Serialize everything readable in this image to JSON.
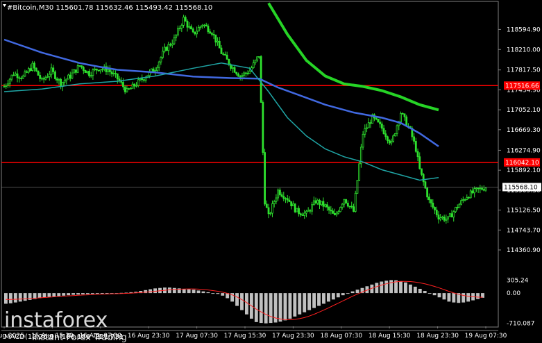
{
  "chart_data": [
    {
      "type": "candlestick",
      "title": "#Bitcoin,M30  115601.78 115632.46 115493.42 115568.10",
      "symbol": "#Bitcoin",
      "timeframe": "M30",
      "ohlc_header": {
        "open": 115601.78,
        "high": 115632.46,
        "low": 115493.42,
        "close": 115568.1
      },
      "ylim": [
        114360.9,
        119000
      ],
      "y_ticks": [
        "118594.90",
        "118210.00",
        "117817.50",
        "117434.90",
        "117052.10",
        "116669.30",
        "116274.90",
        "115892.10",
        "115509.30",
        "115126.50",
        "114743.70",
        "114360.90"
      ],
      "x_ticks": [
        "15 Aug 2025",
        "15 Aug 15:30",
        "16 Aug 07:30",
        "16 Aug 23:30",
        "17 Aug 07:30",
        "17 Aug 15:30",
        "17 Aug 23:30",
        "18 Aug 07:30",
        "18 Aug 15:30",
        "18 Aug 23:30",
        "19 Aug 07:30"
      ],
      "close_path": [
        [
          0,
          117500
        ],
        [
          5,
          117750
        ],
        [
          10,
          117680
        ],
        [
          15,
          117900
        ],
        [
          20,
          117600
        ],
        [
          25,
          117800
        ],
        [
          30,
          117560
        ],
        [
          35,
          117700
        ],
        [
          40,
          117900
        ],
        [
          45,
          117750
        ],
        [
          50,
          117850
        ],
        [
          55,
          117820
        ],
        [
          60,
          117650
        ],
        [
          65,
          117400
        ],
        [
          70,
          117550
        ],
        [
          75,
          117700
        ],
        [
          80,
          117850
        ],
        [
          85,
          118200
        ],
        [
          90,
          118400
        ],
        [
          95,
          118800
        ],
        [
          100,
          118500
        ],
        [
          105,
          118700
        ],
        [
          110,
          118550
        ],
        [
          115,
          118150
        ],
        [
          120,
          117900
        ],
        [
          125,
          117700
        ],
        [
          130,
          117800
        ],
        [
          135,
          118100
        ],
        [
          138,
          115300
        ],
        [
          140,
          115000
        ],
        [
          145,
          115500
        ],
        [
          150,
          115350
        ],
        [
          155,
          115100
        ],
        [
          160,
          115050
        ],
        [
          165,
          115300
        ],
        [
          170,
          115200
        ],
        [
          175,
          115000
        ],
        [
          180,
          115350
        ],
        [
          185,
          115100
        ],
        [
          190,
          116600
        ],
        [
          195,
          116900
        ],
        [
          200,
          116700
        ],
        [
          205,
          116400
        ],
        [
          210,
          117000
        ],
        [
          215,
          116650
        ],
        [
          218,
          116300
        ],
        [
          220,
          115900
        ],
        [
          225,
          115300
        ],
        [
          230,
          115000
        ],
        [
          235,
          114950
        ],
        [
          240,
          115200
        ],
        [
          245,
          115400
        ],
        [
          250,
          115500
        ],
        [
          255,
          115568
        ]
      ],
      "support_lines": [
        {
          "label": "117516.66",
          "value": 117516.66,
          "color": "#ff0000"
        },
        {
          "label": "116042.10",
          "value": 116042.1,
          "color": "#ff0000"
        }
      ],
      "current_price_label": "115568.10",
      "series": [
        {
          "color": "#26d426",
          "values": [
            [
              140,
              119100
            ],
            [
              150,
              118500
            ],
            [
              160,
              118000
            ],
            [
              170,
              117700
            ],
            [
              180,
              117550
            ],
            [
              190,
              117500
            ],
            [
              200,
              117420
            ],
            [
              210,
              117300
            ],
            [
              220,
              117150
            ],
            [
              230,
              117050
            ]
          ]
        },
        {
          "color": "#4169e1",
          "values": [
            [
              0,
              118400
            ],
            [
              20,
              118150
            ],
            [
              40,
              117950
            ],
            [
              50,
              117880
            ],
            [
              60,
              117820
            ],
            [
              80,
              117770
            ],
            [
              100,
              117690
            ],
            [
              120,
              117660
            ],
            [
              135,
              117650
            ],
            [
              145,
              117480
            ],
            [
              155,
              117350
            ],
            [
              170,
              117150
            ],
            [
              185,
              117000
            ],
            [
              200,
              116900
            ],
            [
              210,
              116800
            ],
            [
              220,
              116600
            ],
            [
              230,
              116350
            ]
          ]
        },
        {
          "color": "#1fa5a5",
          "values": [
            [
              0,
              117400
            ],
            [
              20,
              117450
            ],
            [
              40,
              117550
            ],
            [
              60,
              117600
            ],
            [
              80,
              117700
            ],
            [
              100,
              117850
            ],
            [
              115,
              117950
            ],
            [
              130,
              117850
            ],
            [
              140,
              117400
            ],
            [
              150,
              116900
            ],
            [
              160,
              116550
            ],
            [
              170,
              116300
            ],
            [
              180,
              116150
            ],
            [
              190,
              116050
            ],
            [
              200,
              115900
            ],
            [
              210,
              115800
            ],
            [
              220,
              115700
            ],
            [
              230,
              115750
            ]
          ]
        }
      ],
      "grid": false
    },
    {
      "type": "bar",
      "title": "MACD(12,26,9) -106.186 -221.731",
      "ylim": [
        -780,
        360
      ],
      "y_ticks": [
        "305.24",
        "0.00",
        "-710.087"
      ],
      "histogram": [
        -250,
        -240,
        -220,
        -200,
        -180,
        -160,
        -140,
        -120,
        -100,
        -90,
        -80,
        -70,
        -60,
        -50,
        -40,
        -35,
        -30,
        -25,
        -20,
        -15,
        -10,
        -5,
        -5,
        0,
        5,
        10,
        20,
        30,
        50,
        70,
        90,
        110,
        120,
        130,
        130,
        120,
        110,
        100,
        90,
        80,
        60,
        40,
        20,
        0,
        -20,
        -60,
        -120,
        -200,
        -300,
        -400,
        -500,
        -600,
        -680,
        -700,
        -710,
        -700,
        -690,
        -670,
        -640,
        -600,
        -550,
        -500,
        -450,
        -400,
        -350,
        -300,
        -250,
        -200,
        -150,
        -100,
        -50,
        0,
        40,
        80,
        120,
        160,
        200,
        240,
        270,
        290,
        305,
        300,
        280,
        250,
        200,
        150,
        100,
        50,
        0,
        -50,
        -100,
        -150,
        -200,
        -220,
        -230,
        -220,
        -200,
        -170,
        -140,
        -110
      ],
      "signal": [
        -150,
        -148,
        -145,
        -140,
        -135,
        -128,
        -120,
        -112,
        -104,
        -96,
        -88,
        -80,
        -72,
        -65,
        -58,
        -52,
        -46,
        -40,
        -35,
        -30,
        -25,
        -21,
        -17,
        -14,
        -10,
        -6,
        -1,
        5,
        12,
        21,
        31,
        43,
        55,
        66,
        76,
        85,
        91,
        95,
        97,
        97,
        93,
        85,
        74,
        59,
        42,
        21,
        -6,
        -42,
        -91,
        -153,
        -223,
        -299,
        -376,
        -441,
        -500,
        -548,
        -584,
        -608,
        -621,
        -624,
        -617,
        -600,
        -574,
        -539,
        -497,
        -450,
        -399,
        -346,
        -292,
        -237,
        -182,
        -128,
        -74,
        -24,
        24,
        69,
        112,
        152,
        188,
        219,
        245,
        264,
        274,
        276,
        270,
        258,
        240,
        217,
        189,
        156,
        120,
        81,
        40,
        4,
        -28,
        -55,
        -74,
        -86,
        -94,
        -98
      ]
    }
  ],
  "watermark": {
    "brand": "instaforex",
    "tagline": "Instant Forex Trading"
  }
}
